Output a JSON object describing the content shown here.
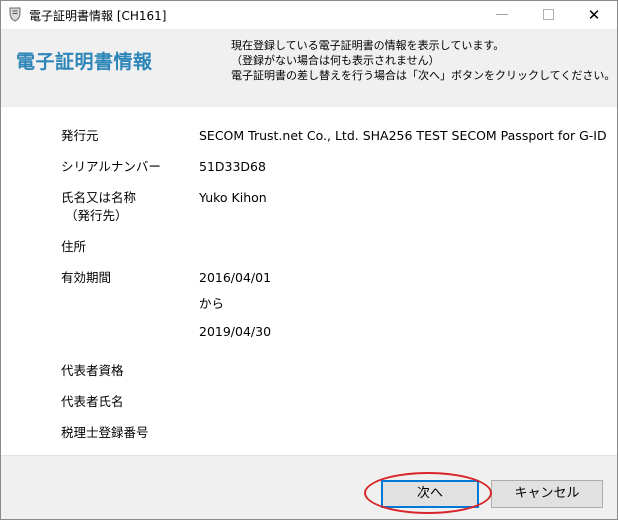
{
  "window": {
    "title": "電子証明書情報 [CH161]",
    "controls": {
      "minimize": "—",
      "close": "✕"
    }
  },
  "header": {
    "title": "電子証明書情報",
    "desc_line1": "現在登録している電子証明書の情報を表示しています。",
    "desc_line2": "（登録がない場合は何も表示されません）",
    "desc_line3": "電子証明書の差し替えを行う場合は「次へ」ボタンをクリックしてください。"
  },
  "fields": {
    "issuer": {
      "label": "発行元",
      "value": "SECOM Trust.net Co., Ltd. SHA256 TEST SECOM Passport for G-ID"
    },
    "serial": {
      "label": "シリアルナンバー",
      "value": "51D33D68"
    },
    "name": {
      "label_line1": "氏名又は名称",
      "label_line2": "（発行先）",
      "value": "Yuko Kihon"
    },
    "address": {
      "label": "住所",
      "value": ""
    },
    "validity": {
      "label": "有効期間",
      "from": "2016/04/01",
      "separator": "から",
      "to": "2019/04/30"
    },
    "rep_qualification": {
      "label": "代表者資格",
      "value": ""
    },
    "rep_name": {
      "label": "代表者氏名",
      "value": ""
    },
    "tax_accountant_no": {
      "label": "税理士登録番号",
      "value": ""
    }
  },
  "buttons": {
    "next": "次へ",
    "cancel": "キャンセル"
  },
  "colors": {
    "header_title": "#2e86b8",
    "highlight": "#d9252a",
    "panel_bg": "#f0f0f0"
  }
}
